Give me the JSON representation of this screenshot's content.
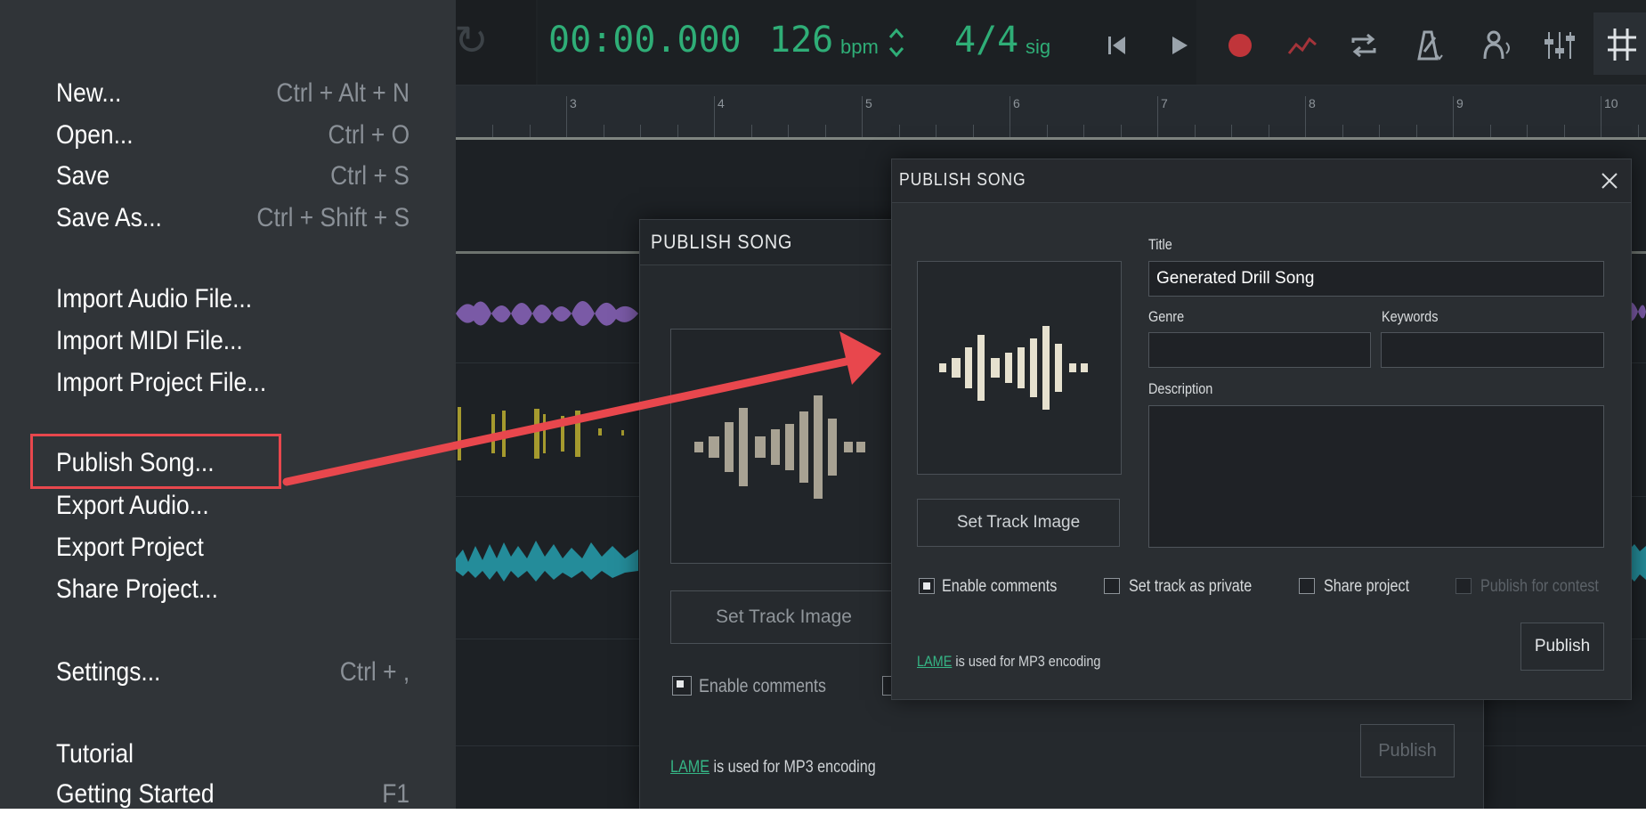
{
  "transport": {
    "time": "00:00.000",
    "tempo_value": "126",
    "tempo_unit": "bpm",
    "tempo_stepper_icon": "up-down-chevron-icon",
    "signature_value": "4/4",
    "signature_unit": "sig",
    "icons": [
      "skip-to-start-icon",
      "play-icon",
      "record-icon",
      "automation-icon",
      "loop-icon",
      "metronome-icon",
      "tuner-icon",
      "mixer-icon",
      "grid-icon"
    ],
    "accent_color": "#2fae77",
    "record_color": "#c0353a"
  },
  "ruler": {
    "bars": [
      "3",
      "4",
      "5",
      "6",
      "7",
      "8",
      "9",
      "10"
    ]
  },
  "file_menu": {
    "items": [
      {
        "label": "New...",
        "shortcut": "Ctrl + Alt + N"
      },
      {
        "label": "Open...",
        "shortcut": "Ctrl + O"
      },
      {
        "label": "Save",
        "shortcut": "Ctrl + S"
      },
      {
        "label": "Save As...",
        "shortcut": "Ctrl + Shift + S"
      },
      {
        "label": "Import Audio File...",
        "shortcut": ""
      },
      {
        "label": "Import MIDI File...",
        "shortcut": ""
      },
      {
        "label": "Import Project File...",
        "shortcut": ""
      },
      {
        "label": "Publish Song...",
        "shortcut": ""
      },
      {
        "label": "Export Audio...",
        "shortcut": ""
      },
      {
        "label": "Export Project",
        "shortcut": ""
      },
      {
        "label": "Share Project...",
        "shortcut": ""
      },
      {
        "label": "Settings...",
        "shortcut": "Ctrl + ,"
      },
      {
        "label": "Tutorial",
        "shortcut": ""
      },
      {
        "label": "Getting Started",
        "shortcut": "F1"
      }
    ],
    "highlighted_item": "Publish Song..."
  },
  "annotation": {
    "arrow_color": "#e8474d",
    "highlight_color": "#e8474d"
  },
  "back_dialog": {
    "title": "PUBLISH SONG",
    "set_image_label": "Set Track Image",
    "enable_comments_label": "Enable comments",
    "enable_comments_checked": true,
    "lame_link": "LAME",
    "lame_text": "is used for MP3 encoding",
    "publish_label": "Publish"
  },
  "publish_dialog": {
    "title": "PUBLISH SONG",
    "close_icon": "close-icon",
    "title_label": "Title",
    "title_value": "Generated Drill Song",
    "genre_label": "Genre",
    "genre_value": "",
    "keywords_label": "Keywords",
    "keywords_value": "",
    "description_label": "Description",
    "description_value": "",
    "set_image_label": "Set Track Image",
    "checkboxes": [
      {
        "label": "Enable comments",
        "checked": true,
        "disabled": false
      },
      {
        "label": "Set track as private",
        "checked": false,
        "disabled": false
      },
      {
        "label": "Share project",
        "checked": false,
        "disabled": false
      },
      {
        "label": "Publish for contest",
        "checked": false,
        "disabled": true
      }
    ],
    "lame_link": "LAME",
    "lame_text": "is used for MP3 encoding",
    "publish_label": "Publish"
  }
}
